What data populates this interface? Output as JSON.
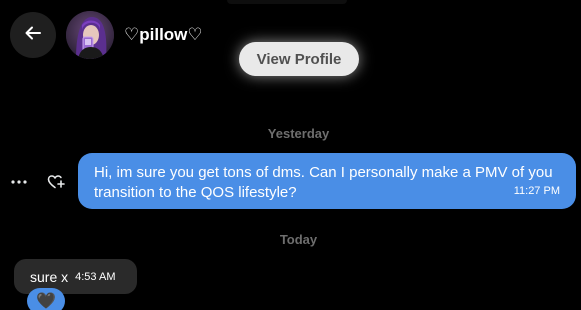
{
  "header": {
    "back_icon": "arrow-left-icon",
    "display_name": "♡pillow♡",
    "view_profile_label": "View Profile"
  },
  "conversation": {
    "days": [
      {
        "label": "Yesterday",
        "messages": [
          {
            "direction": "outgoing",
            "text": "Hi, im sure you get tons of dms. Can I personally make a PMV of you transition to the QOS lifestyle?",
            "time": "11:27 PM"
          }
        ]
      },
      {
        "label": "Today",
        "messages": [
          {
            "direction": "incoming",
            "text": "sure x",
            "time": "4:53 AM",
            "reaction": "🖤"
          }
        ]
      }
    ]
  },
  "actions": {
    "more_icon": "more-horizontal-icon",
    "react_icon": "heart-plus-icon"
  },
  "colors": {
    "background": "#000000",
    "outgoing_bubble": "#4a8ee6",
    "incoming_bubble": "#2a2a2a",
    "muted_text": "#6e6e6e"
  }
}
